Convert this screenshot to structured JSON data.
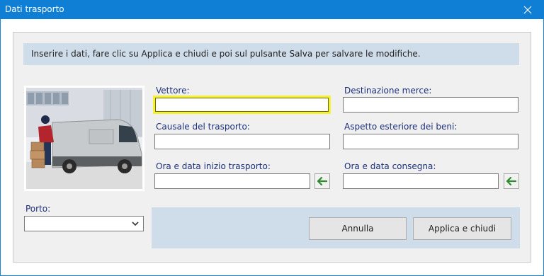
{
  "window": {
    "title": "Dati trasporto"
  },
  "info": {
    "text": "Inserire i dati, fare clic su Applica e chiudi e poi sul pulsante Salva per salvare le modifiche."
  },
  "form": {
    "vettore": {
      "label": "Vettore:",
      "value": ""
    },
    "destinazione": {
      "label": "Destinazione merce:",
      "value": ""
    },
    "causale": {
      "label": "Causale del trasporto:",
      "value": ""
    },
    "aspetto": {
      "label": "Aspetto esteriore dei beni:",
      "value": ""
    },
    "inizio": {
      "label": "Ora e data inizio trasporto:",
      "value": ""
    },
    "consegna": {
      "label": "Ora e data consegna:",
      "value": ""
    },
    "porto": {
      "label": "Porto:",
      "value": ""
    }
  },
  "buttons": {
    "annulla": "Annulla",
    "applica": "Applica e chiudi"
  },
  "icons": {
    "close": "close-icon",
    "arrow": "arrow-left-icon",
    "chevron": "chevron-down-icon"
  },
  "colors": {
    "titlebar": "#0f7fd6",
    "label": "#1c2f7a",
    "accent_arrow": "#2e8b2e",
    "focus": "#f5f233"
  }
}
